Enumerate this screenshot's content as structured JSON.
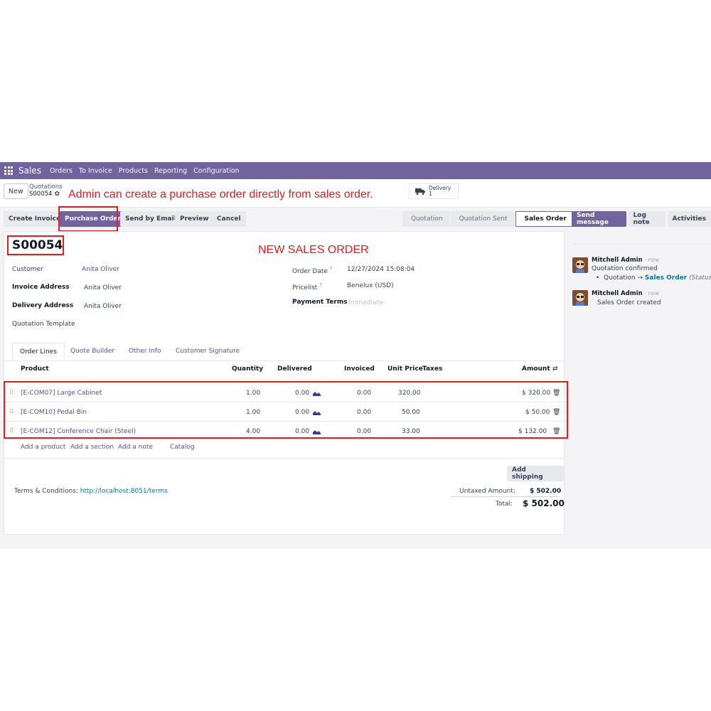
{
  "navbar": {
    "brand": "Sales",
    "items": [
      "Orders",
      "To Invoice",
      "Products",
      "Reporting",
      "Configuration"
    ]
  },
  "control_panel": {
    "new_label": "New",
    "breadcrumb_parent": "Quotations",
    "breadcrumb_current": "S00054",
    "annotation": "Admin can create a purchase order directly from sales order.",
    "smart_button": {
      "label": "Delivery",
      "count": "1"
    }
  },
  "actions": {
    "create_invoice": "Create Invoice",
    "purchase_order": "Purchase Order",
    "send_by_email": "Send by Email",
    "preview": "Preview",
    "cancel": "Cancel"
  },
  "status": {
    "steps": [
      "Quotation",
      "Quotation Sent",
      "Sales Order"
    ],
    "active": "Sales Order"
  },
  "chatter_buttons": {
    "send_message": "Send message",
    "log_note": "Log note",
    "activities": "Activities"
  },
  "form": {
    "name": "S00054",
    "annotation": "NEW SALES ORDER",
    "customer_label": "Customer",
    "customer_value": "Anita Oliver",
    "invoice_address_label": "Invoice Address",
    "invoice_address_value": "Anita Oliver",
    "delivery_address_label": "Delivery Address",
    "delivery_address_value": "Anita Oliver",
    "quotation_template_label": "Quotation Template",
    "order_date_label": "Order Date",
    "order_date_value": "12/27/2024 15:08:04",
    "pricelist_label": "Pricelist",
    "pricelist_value": "Benelux (USD)",
    "payment_terms_label": "Payment Terms",
    "payment_terms_placeholder": "Immediate",
    "help_mark": "?"
  },
  "tabs": [
    "Order Lines",
    "Quote Builder",
    "Other Info",
    "Customer Signature"
  ],
  "table": {
    "headers": {
      "product": "Product",
      "quantity": "Quantity",
      "delivered": "Delivered",
      "invoiced": "Invoiced",
      "unit_price": "Unit Price",
      "taxes": "Taxes",
      "amount": "Amount"
    },
    "rows": [
      {
        "product": "[E-COM07] Large Cabinet",
        "quantity": "1.00",
        "delivered": "0.00",
        "invoiced": "0.00",
        "unit_price": "320.00",
        "amount": "$ 320.00"
      },
      {
        "product": "[E-COM10] Pedal Bin",
        "quantity": "1.00",
        "delivered": "0.00",
        "invoiced": "0.00",
        "unit_price": "50.00",
        "amount": "$ 50.00"
      },
      {
        "product": "[E-COM12] Conference Chair (Steel)",
        "quantity": "4.00",
        "delivered": "0.00",
        "invoiced": "0.00",
        "unit_price": "33.00",
        "amount": "$ 132.00"
      }
    ]
  },
  "add_links": {
    "add_product": "Add a product",
    "add_section": "Add a section",
    "add_note": "Add a note",
    "catalog": "Catalog"
  },
  "footer": {
    "add_shipping": "Add shipping",
    "terms_label": "Terms & Conditions:",
    "terms_link": "http://localhost:8051/terms",
    "untaxed_label": "Untaxed Amount:",
    "untaxed_value": "$ 502.00",
    "total_label": "Total:",
    "total_value": "$ 502.00"
  },
  "chatter": {
    "messages": [
      {
        "author": "Mitchell Admin",
        "time": "- now",
        "line1": "Quotation confirmed",
        "tracking_from": "Quotation",
        "tracking_arrow": "→",
        "tracking_to": "Sales Order",
        "tracking_field": "(Status)"
      },
      {
        "author": "Mitchell Admin",
        "time": "- now",
        "line1": "Sales Order created"
      }
    ]
  },
  "colors": {
    "brand": "#71639e",
    "annotation_red": "#e11d1d",
    "link": "#5b4d8f",
    "teal_link": "#0e7490"
  }
}
